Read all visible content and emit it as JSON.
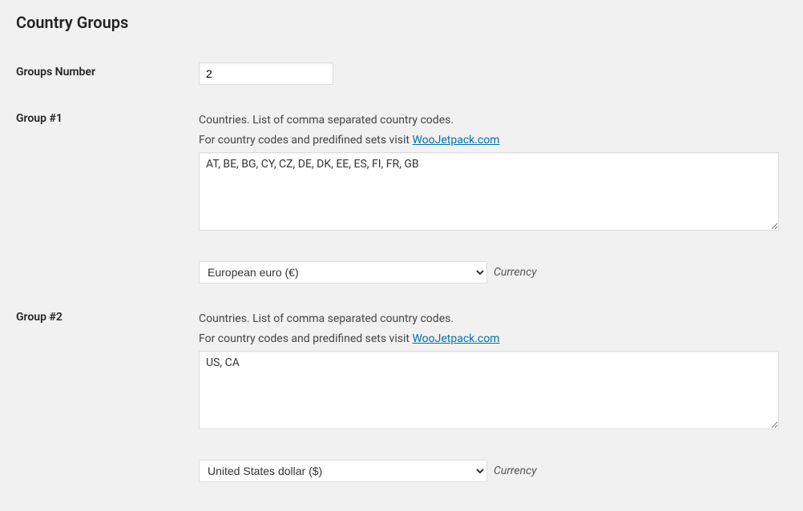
{
  "heading": "Country Groups",
  "groupsNumber": {
    "label": "Groups Number",
    "value": "2"
  },
  "help": {
    "line1": "Countries. List of comma separated country codes.",
    "line2_prefix": "For country codes and predifined sets visit ",
    "link_text": "WooJetpack.com",
    "link_href": "#"
  },
  "currencyLabel": "Currency",
  "groups": [
    {
      "label": "Group #1",
      "countries": "AT, BE, BG, CY, CZ, DE, DK, EE, ES, FI, FR, GB",
      "currency": "European euro (€)"
    },
    {
      "label": "Group #2",
      "countries": "US, CA",
      "currency": "United States dollar ($)"
    }
  ]
}
